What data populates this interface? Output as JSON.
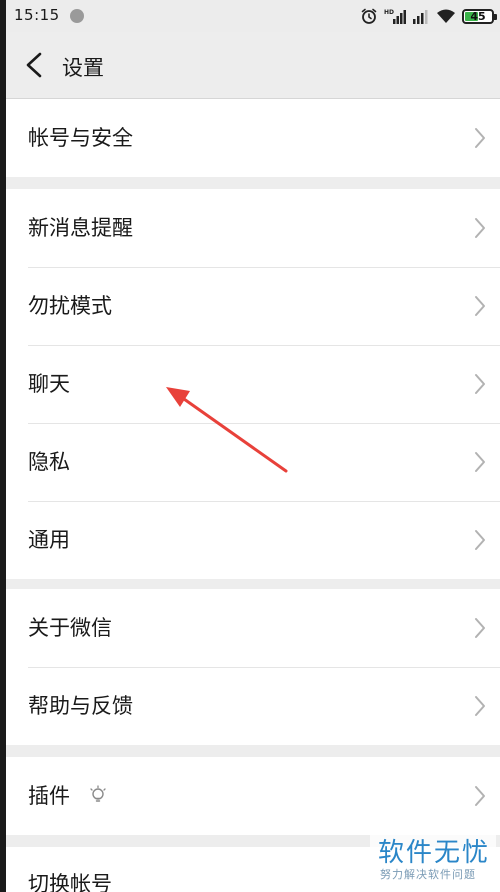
{
  "status_bar": {
    "time": "15:15",
    "battery": "45",
    "battery_level": 0.45
  },
  "header": {
    "title": "设置"
  },
  "groups": [
    {
      "items": [
        {
          "label": "帐号与安全"
        }
      ]
    },
    {
      "items": [
        {
          "label": "新消息提醒"
        },
        {
          "label": "勿扰模式"
        },
        {
          "label": "聊天"
        },
        {
          "label": "隐私"
        },
        {
          "label": "通用"
        }
      ]
    },
    {
      "items": [
        {
          "label": "关于微信"
        },
        {
          "label": "帮助与反馈"
        }
      ]
    },
    {
      "items": [
        {
          "label": "插件"
        }
      ]
    },
    {
      "items": [
        {
          "label": "切换帐号"
        }
      ]
    }
  ],
  "watermark": {
    "logo_text": "软件无忧",
    "subtitle": "努力解决软件问题"
  },
  "colors": {
    "background": "#ededed",
    "cell": "#ffffff",
    "annotation_arrow": "#e8413a",
    "watermark_blue": "#2a86c8"
  },
  "icons": [
    "back-chevron-icon",
    "chevron-right-icon",
    "plugin-bulb-icon",
    "alarm-icon",
    "signal-icon",
    "wifi-icon",
    "battery-icon"
  ]
}
